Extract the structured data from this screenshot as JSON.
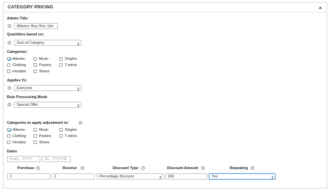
{
  "panel": {
    "title": "CATEGORY PRICING",
    "collapse_icon": "triangle-up-icon"
  },
  "admin_title": {
    "label": "Admin Title:",
    "value": "Albums: Buy One, Get"
  },
  "quantities": {
    "label": "Quantities based on:",
    "selected": "Sum of Category"
  },
  "categories": {
    "label": "Categories:",
    "items": [
      {
        "label": "Albums",
        "checked": true
      },
      {
        "label": "Music",
        "checked": false
      },
      {
        "label": "Singles",
        "checked": false
      },
      {
        "label": "Clothing",
        "checked": false
      },
      {
        "label": "Posters",
        "checked": false
      },
      {
        "label": "T-shirts",
        "checked": false
      },
      {
        "label": "Hoodies",
        "checked": false
      },
      {
        "label": "Shoes",
        "checked": false
      }
    ]
  },
  "applies_to": {
    "label": "Applies To:",
    "selected": "Everyone"
  },
  "rule_mode": {
    "label": "Rule Processing Mode",
    "selected": "Special Offer"
  },
  "adjust_categories": {
    "label": "Categories to apply adjustment to:",
    "items": [
      {
        "label": "Albums",
        "checked": true
      },
      {
        "label": "Music",
        "checked": false
      },
      {
        "label": "Singles",
        "checked": false
      },
      {
        "label": "Clothing",
        "checked": false
      },
      {
        "label": "Posters",
        "checked": false
      },
      {
        "label": "T-shirts",
        "checked": false
      },
      {
        "label": "Hoodies",
        "checked": false
      },
      {
        "label": "Shoes",
        "checked": false
      }
    ]
  },
  "dates": {
    "label": "Dates",
    "from_placeholder": "From... YYYY",
    "to_placeholder": "To... YYYY-M"
  },
  "table": {
    "headers": [
      "Purchase",
      "Receive",
      "Discount Type",
      "Discount Amount",
      "Repeating"
    ],
    "row": {
      "purchase": "1",
      "receive": "1",
      "discount_type": "Percentage Discount",
      "discount_amount": "100",
      "repeating": "Yes"
    }
  },
  "colors": {
    "border": "#dcdcdc",
    "focus": "#5b9dd9",
    "text": "#23282d"
  }
}
